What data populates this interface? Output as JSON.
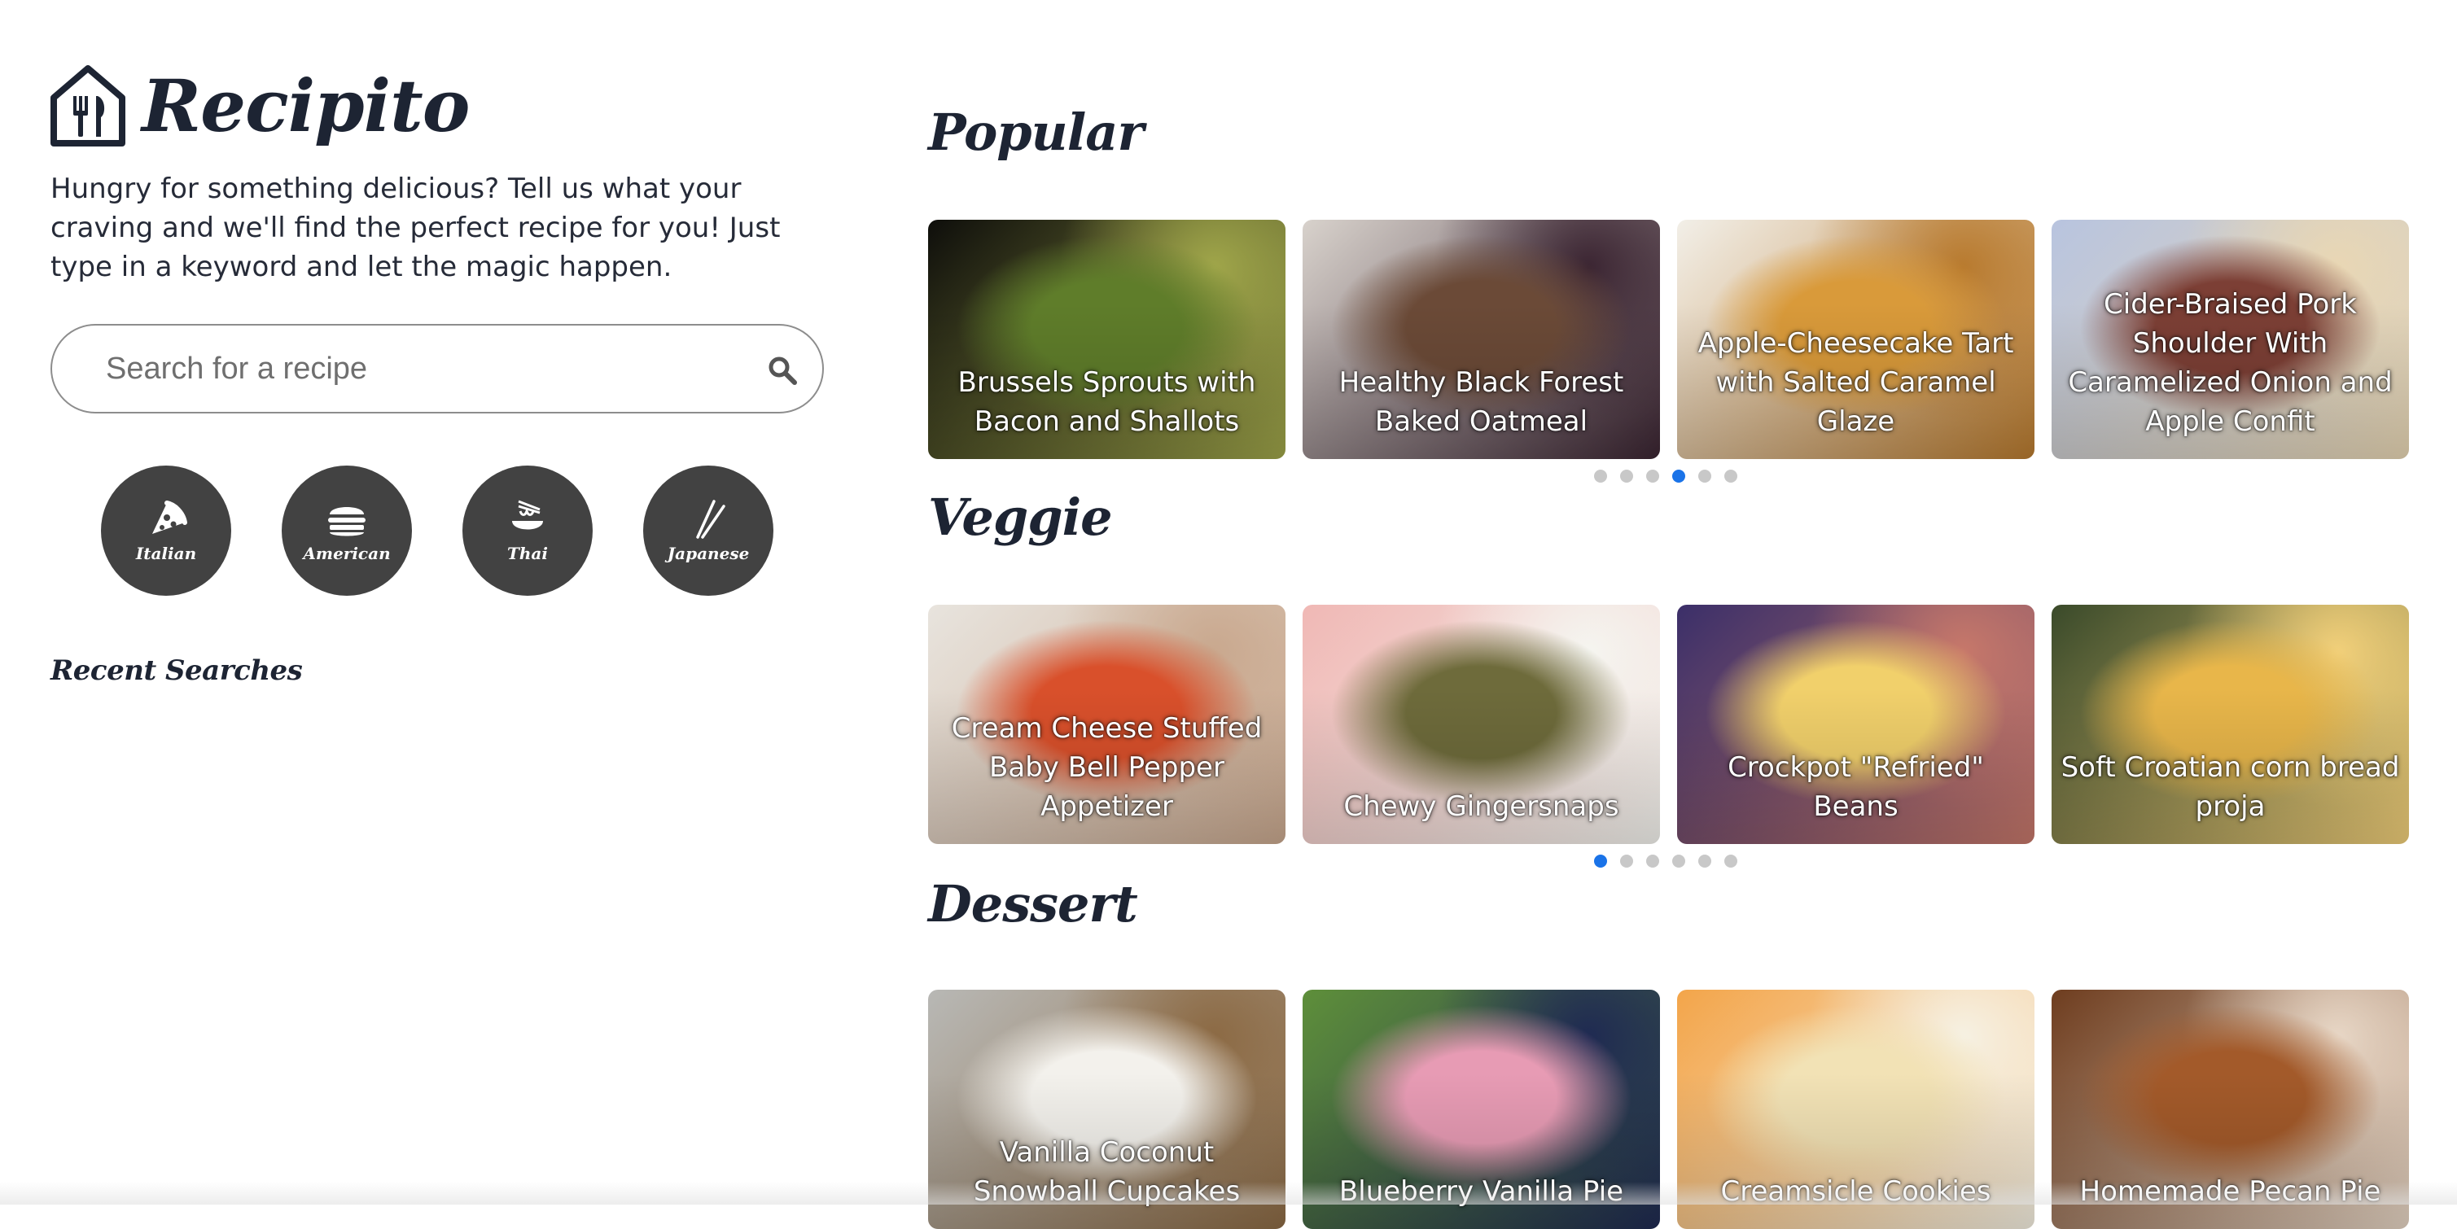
{
  "brand": {
    "name": "Recipito"
  },
  "tagline": "Hungry for something delicious? Tell us what your craving and we'll find the perfect recipe for you! Just type in a keyword and let the magic happen.",
  "search": {
    "placeholder": "Search for a recipe",
    "value": ""
  },
  "cuisines": [
    {
      "label": "Italian",
      "icon": "pizza-icon"
    },
    {
      "label": "American",
      "icon": "burger-icon"
    },
    {
      "label": "Thai",
      "icon": "noodle-bowl-icon"
    },
    {
      "label": "Japanese",
      "icon": "chopsticks-icon"
    }
  ],
  "recent_searches": {
    "title": "Recent Searches",
    "items": []
  },
  "sections": {
    "popular": {
      "title": "Popular",
      "active_dot": 3,
      "dot_count": 6,
      "cards": [
        {
          "title": "Brussels Sprouts with Bacon and Shallots",
          "colors": [
            "#0e0e0b",
            "#5f7d2a",
            "#a0a64a"
          ]
        },
        {
          "title": "Healthy Black Forest Baked Oatmeal",
          "colors": [
            "#d8d2cc",
            "#6b4a37",
            "#3b2532"
          ]
        },
        {
          "title": "Apple-Cheesecake Tart with Salted Caramel Glaze",
          "colors": [
            "#f2efe8",
            "#d99a3a",
            "#b87a2e"
          ]
        },
        {
          "title": "Cider-Braised Pork Shoulder With Caramelized Onion and Apple Confit",
          "colors": [
            "#b8c4df",
            "#7c3f35",
            "#e9d7b4"
          ]
        }
      ]
    },
    "veggie": {
      "title": "Veggie",
      "active_dot": 0,
      "dot_count": 6,
      "cards": [
        {
          "title": "Cream Cheese Stuffed Baby Bell Pepper Appetizer",
          "colors": [
            "#e8e4de",
            "#d9502b",
            "#c9a88e"
          ]
        },
        {
          "title": "Chewy Gingersnaps",
          "colors": [
            "#f0b8b5",
            "#6e6b3b",
            "#f5f5f0"
          ]
        },
        {
          "title": "Crockpot \"Refried\" Beans",
          "colors": [
            "#3b2f69",
            "#f1d06b",
            "#c7786a"
          ]
        },
        {
          "title": "Soft Croatian corn bread proja",
          "colors": [
            "#3a4a2a",
            "#e8b64a",
            "#f2d07a"
          ]
        }
      ]
    },
    "dessert": {
      "title": "Dessert",
      "cards": [
        {
          "title": "Vanilla Coconut Snowball Cupcakes",
          "colors": [
            "#b8b8b5",
            "#f3f1ec",
            "#8c6a44"
          ]
        },
        {
          "title": "Blueberry Vanilla Pie",
          "colors": [
            "#5e8f3a",
            "#e79bb4",
            "#1f2a52"
          ]
        },
        {
          "title": "Creamsicle Cookies",
          "colors": [
            "#f3a54a",
            "#f2e2b5",
            "#f6f1e3"
          ]
        },
        {
          "title": "Homemade Pecan Pie",
          "colors": [
            "#6e3d1f",
            "#a35a2a",
            "#e8d7c6"
          ]
        }
      ]
    }
  }
}
